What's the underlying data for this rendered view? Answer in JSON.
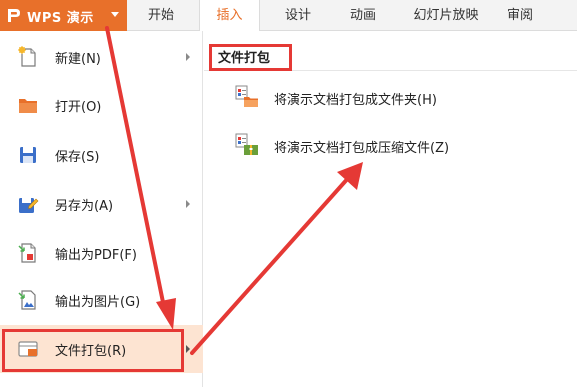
{
  "app": {
    "title": "WPS 演示"
  },
  "ribbon": {
    "tabs": [
      {
        "label": "开始",
        "active": false
      },
      {
        "label": "插入",
        "active": true
      },
      {
        "label": "设计",
        "active": false
      },
      {
        "label": "动画",
        "active": false
      },
      {
        "label": "幻灯片放映",
        "active": false
      },
      {
        "label": "审阅",
        "active": false
      }
    ]
  },
  "menu": {
    "items": [
      {
        "label": "新建(N)",
        "icon": "new-document-icon",
        "submenu": true
      },
      {
        "label": "打开(O)",
        "icon": "folder-icon",
        "submenu": false
      },
      {
        "label": "保存(S)",
        "icon": "floppy-disk-icon",
        "submenu": false
      },
      {
        "label": "另存为(A)",
        "icon": "save-as-icon",
        "submenu": true
      },
      {
        "label": "输出为PDF(F)",
        "icon": "pdf-icon",
        "submenu": false
      },
      {
        "label": "输出为图片(G)",
        "icon": "image-export-icon",
        "submenu": false
      },
      {
        "label": "文件打包(R)",
        "icon": "file-package-icon",
        "submenu": true,
        "highlighted": true
      }
    ]
  },
  "panel": {
    "title": "文件打包",
    "options": [
      {
        "label": "将演示文档打包成文件夹(H)",
        "icon": "package-to-folder-icon"
      },
      {
        "label": "将演示文档打包成压缩文件(Z)",
        "icon": "package-to-zip-icon"
      }
    ]
  },
  "colors": {
    "brand": "#e8702a",
    "highlight": "#fde4d2",
    "annotation": "#e53935"
  }
}
